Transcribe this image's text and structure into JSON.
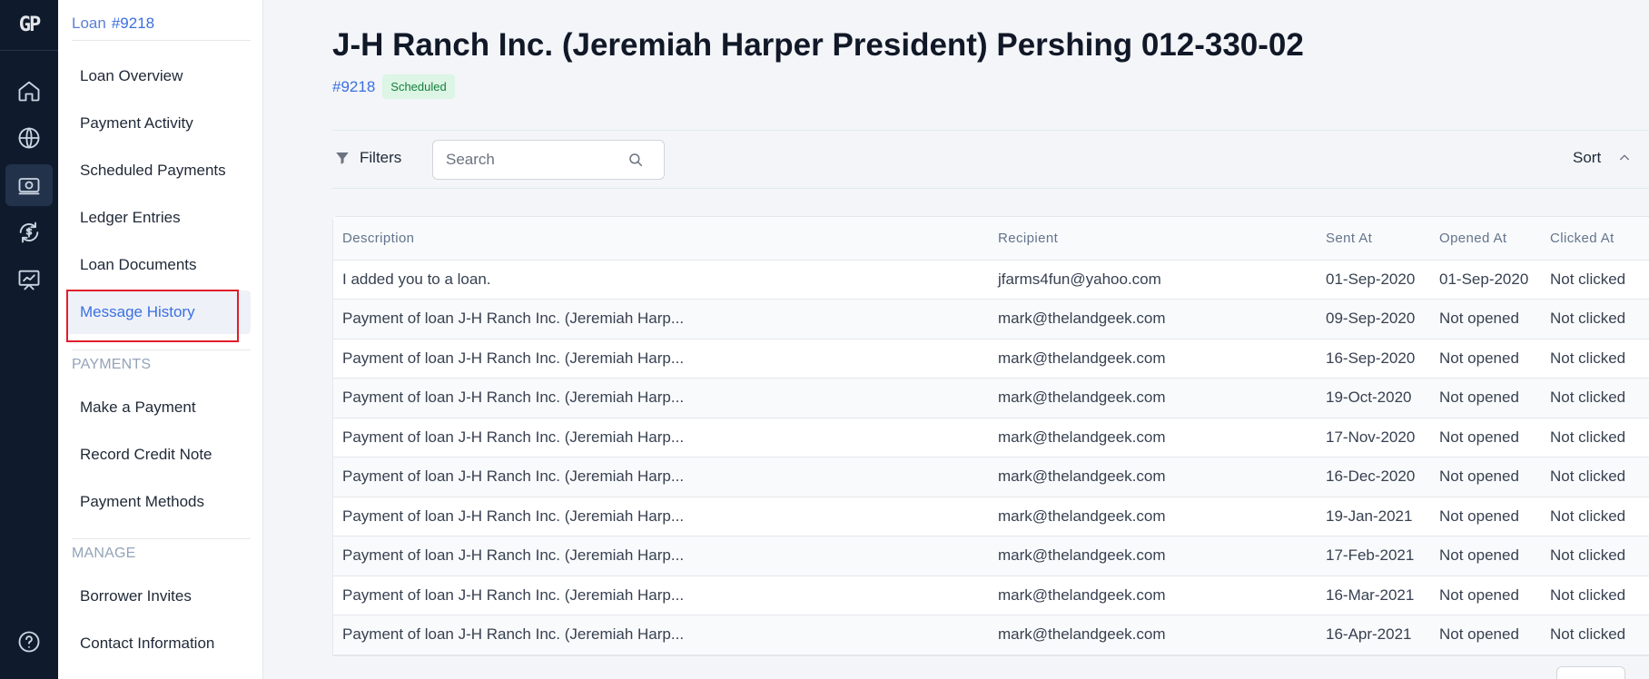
{
  "rail": {
    "logo": "GP",
    "icons": [
      "home-icon",
      "globe-icon",
      "money-icon",
      "exchange-icon",
      "chart-icon",
      "help-icon"
    ]
  },
  "sidenav": {
    "loan_label": "Loan",
    "loan_number": "#9218",
    "items": [
      {
        "label": "Loan Overview"
      },
      {
        "label": "Payment Activity"
      },
      {
        "label": "Scheduled Payments"
      },
      {
        "label": "Ledger Entries"
      },
      {
        "label": "Loan Documents"
      },
      {
        "label": "Message History"
      }
    ],
    "payments_section": "PAYMENTS",
    "payments_items": [
      {
        "label": "Make a Payment"
      },
      {
        "label": "Record Credit Note"
      },
      {
        "label": "Payment Methods"
      }
    ],
    "manage_section": "MANAGE",
    "manage_items": [
      {
        "label": "Borrower Invites"
      },
      {
        "label": "Contact Information"
      }
    ]
  },
  "header": {
    "title": "J-H Ranch Inc. (Jeremiah Harper President) Pershing 012-330-02",
    "loan_link": "#9218",
    "status": "Scheduled"
  },
  "toolbar": {
    "filters_label": "Filters",
    "search_placeholder": "Search",
    "sort_label": "Sort"
  },
  "table": {
    "columns": [
      "Description",
      "Recipient",
      "Sent At",
      "Opened At",
      "Clicked At"
    ],
    "rows": [
      [
        "I added you to a loan.",
        "jfarms4fun@yahoo.com",
        "01-Sep-2020",
        "01-Sep-2020",
        "Not clicked"
      ],
      [
        "Payment of loan J-H Ranch Inc. (Jeremiah Harp...",
        "mark@thelandgeek.com",
        "09-Sep-2020",
        "Not opened",
        "Not clicked"
      ],
      [
        "Payment of loan J-H Ranch Inc. (Jeremiah Harp...",
        "mark@thelandgeek.com",
        "16-Sep-2020",
        "Not opened",
        "Not clicked"
      ],
      [
        "Payment of loan J-H Ranch Inc. (Jeremiah Harp...",
        "mark@thelandgeek.com",
        "19-Oct-2020",
        "Not opened",
        "Not clicked"
      ],
      [
        "Payment of loan J-H Ranch Inc. (Jeremiah Harp...",
        "mark@thelandgeek.com",
        "17-Nov-2020",
        "Not opened",
        "Not clicked"
      ],
      [
        "Payment of loan J-H Ranch Inc. (Jeremiah Harp...",
        "mark@thelandgeek.com",
        "16-Dec-2020",
        "Not opened",
        "Not clicked"
      ],
      [
        "Payment of loan J-H Ranch Inc. (Jeremiah Harp...",
        "mark@thelandgeek.com",
        "19-Jan-2021",
        "Not opened",
        "Not clicked"
      ],
      [
        "Payment of loan J-H Ranch Inc. (Jeremiah Harp...",
        "mark@thelandgeek.com",
        "17-Feb-2021",
        "Not opened",
        "Not clicked"
      ],
      [
        "Payment of loan J-H Ranch Inc. (Jeremiah Harp...",
        "mark@thelandgeek.com",
        "16-Mar-2021",
        "Not opened",
        "Not clicked"
      ],
      [
        "Payment of loan J-H Ranch Inc. (Jeremiah Harp...",
        "mark@thelandgeek.com",
        "16-Apr-2021",
        "Not opened",
        "Not clicked"
      ]
    ]
  }
}
